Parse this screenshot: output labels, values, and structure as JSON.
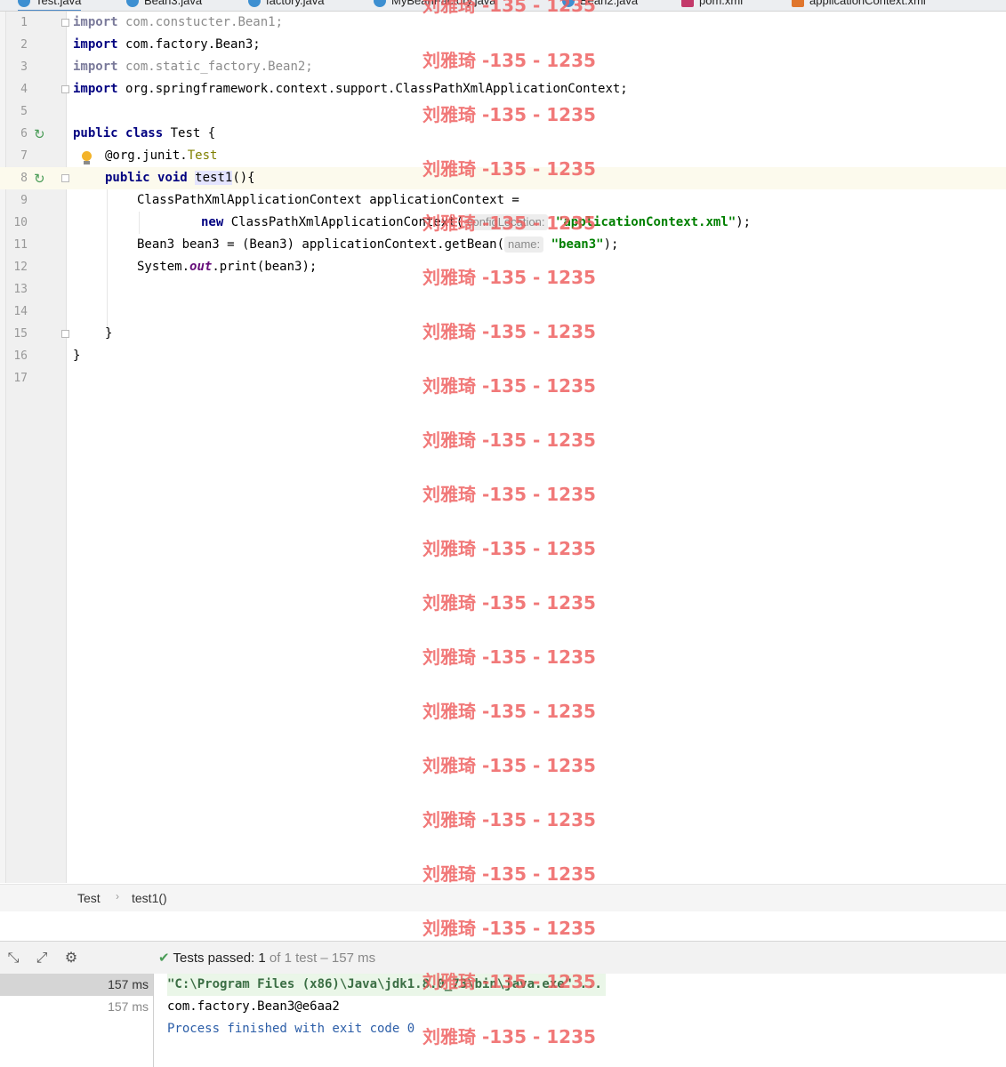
{
  "tabs": [
    {
      "label": "Test.java",
      "active": true,
      "icon": "java-class-icon"
    },
    {
      "label": "Bean3.java",
      "active": false,
      "icon": "java-class-icon"
    },
    {
      "label": "factory.java",
      "active": false,
      "icon": "java-class-icon"
    },
    {
      "label": "MyBeanFactory.java",
      "active": false,
      "icon": "java-class-icon"
    },
    {
      "label": "Bean2.java",
      "active": false,
      "icon": "java-class-icon"
    },
    {
      "label": "pom.xml",
      "active": false,
      "icon": "maven-icon"
    },
    {
      "label": "applicationContext.xml",
      "active": false,
      "icon": "xml-file-icon"
    }
  ],
  "editor": {
    "line_numbers": [
      "1",
      "2",
      "3",
      "4",
      "5",
      "6",
      "7",
      "8",
      "9",
      "10",
      "11",
      "12",
      "13",
      "14",
      "15",
      "16",
      "17"
    ],
    "code": {
      "l1_kw": "import",
      "l1_rest": " com.constucter.Bean1;",
      "l2_kw": "import",
      "l2_rest": " com.factory.Bean3;",
      "l3_kw": "import",
      "l3_rest": " com.static_factory.Bean2;",
      "l4_kw": "import",
      "l4_rest": " org.springframework.context.support.ClassPathXmlApplicationContext;",
      "l6_kw1": "public",
      "l6_kw2": "class",
      "l6_rest": " Test {",
      "l7_at": "@org.junit.",
      "l7_ann": "Test",
      "l8_kw1": "public",
      "l8_kw2": "void",
      "l8_method": "test1",
      "l8_rest": "(){",
      "l9": "ClassPathXmlApplicationContext applicationContext =",
      "l10_kw": "new",
      "l10_mid": " ClassPathXmlApplicationContext(",
      "l10_hint": "configLocation:",
      "l10_str": "\"applicationContext.xml\"",
      "l10_end": ");",
      "l11_a": "Bean3 bean3 = (Bean3) applicationContext.getBean(",
      "l11_hint": "name:",
      "l11_str": "\"bean3\"",
      "l11_end": ");",
      "l12_a": "System.",
      "l12_field": "out",
      "l12_b": ".print(bean3);",
      "l15": "}",
      "l16": "}"
    }
  },
  "breadcrumb": {
    "class": "Test",
    "method": "test1()"
  },
  "run": {
    "status_label": "Tests passed:",
    "status_count": "1",
    "status_rest": "of 1 test – 157 ms",
    "tree": [
      {
        "duration": "157 ms"
      },
      {
        "duration": "157 ms"
      }
    ],
    "console": {
      "cmd": "\"C:\\Program Files (x86)\\Java\\jdk1.8.0_73\\bin\\java.exe\" ...",
      "output": "com.factory.Bean3@e6aa2",
      "exit": "Process finished with exit code 0"
    }
  },
  "watermark": "刘雅琦 -135 - 1235",
  "colors": {
    "keyword": "#000080",
    "string": "#008000",
    "annotation": "#808000",
    "watermark": "#ee5c5c",
    "pass": "#4a9c57"
  }
}
